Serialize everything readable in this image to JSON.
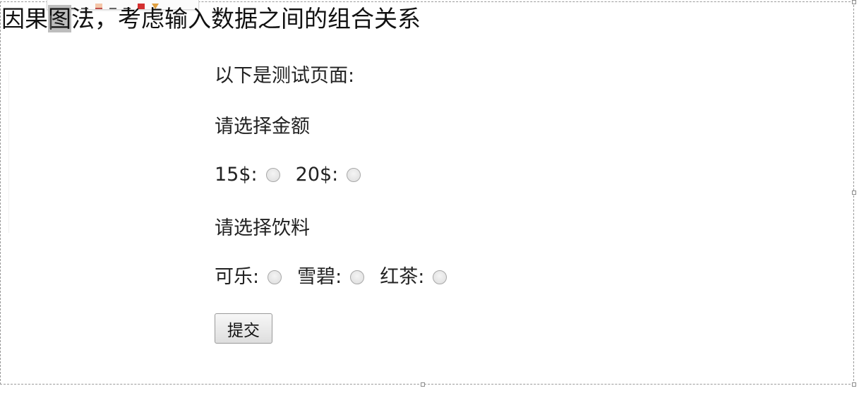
{
  "heading": {
    "before_sel": "因果",
    "selected": "图",
    "after_sel": "法，考虑输入数据之间的组合关系"
  },
  "test_page": {
    "intro": "以下是测试页面:",
    "amount_label": "请选择金额",
    "amount_options": [
      {
        "label": "15$:"
      },
      {
        "label": "20$:"
      }
    ],
    "drink_label": "请选择饮料",
    "drink_options": [
      {
        "label": "可乐:"
      },
      {
        "label": "雪碧:"
      },
      {
        "label": "红茶:"
      }
    ],
    "submit_label": "提交"
  },
  "mini_toolbar": {
    "icons": [
      "font-size-icon",
      "font-size-icon",
      "underline-icon",
      "highlight-icon",
      "underline-icon",
      "underline-icon",
      "font-color-icon",
      "format-painter-icon"
    ]
  }
}
